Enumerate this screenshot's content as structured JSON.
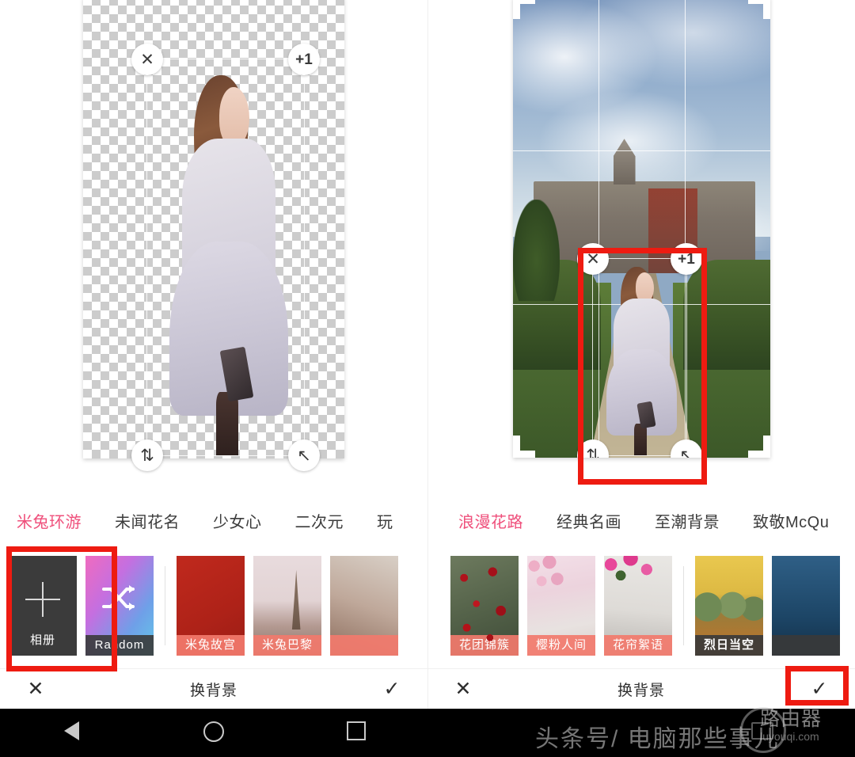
{
  "app": {
    "bottom_bar_title": "换背景",
    "cancel_icon": "✕",
    "confirm_icon": "✓"
  },
  "left_screen": {
    "canvas_type": "transparent-checkerboard",
    "selection": {
      "delete_label": "✕",
      "count_badge": "+1",
      "flip_label": "⇅",
      "resize_label": "↖"
    },
    "tabs": [
      {
        "label": "米兔环游",
        "active": true
      },
      {
        "label": "未闻花名",
        "active": false
      },
      {
        "label": "少女心",
        "active": false
      },
      {
        "label": "二次元",
        "active": false
      },
      {
        "label": "玩",
        "active": false
      }
    ],
    "thumbs": [
      {
        "label": "相册",
        "kind": "album-picker"
      },
      {
        "label": "Random",
        "kind": "random"
      },
      {
        "label": "米兔故宫",
        "kind": "photo"
      },
      {
        "label": "米兔巴黎",
        "kind": "photo"
      },
      {
        "label": "",
        "kind": "photo"
      }
    ],
    "bottom": {
      "cancel": "✕",
      "title": "换背景",
      "confirm": "✓"
    }
  },
  "right_screen": {
    "canvas_type": "photo-castle-garden",
    "selection": {
      "delete_label": "✕",
      "count_badge": "+1",
      "flip_label": "⇅",
      "resize_label": "↖"
    },
    "tabs": [
      {
        "label": "浪漫花路",
        "active": true
      },
      {
        "label": "经典名画",
        "active": false
      },
      {
        "label": "至潮背景",
        "active": false
      },
      {
        "label": "致敬McQu",
        "active": false
      }
    ],
    "thumbs": [
      {
        "label": "花团锦簇",
        "kind": "photo"
      },
      {
        "label": "樱粉人间",
        "kind": "photo"
      },
      {
        "label": "花帘絮语",
        "kind": "photo"
      },
      {
        "label": "烈日当空",
        "kind": "painting"
      },
      {
        "label": "",
        "kind": "painting"
      }
    ],
    "bottom": {
      "cancel": "✕",
      "title": "换背景",
      "confirm": "✓"
    }
  },
  "navbar": {
    "back": "back-triangle",
    "home": "home-circle",
    "recents": "recents-square"
  },
  "watermark": {
    "main": "头条号/ 电脑那些事儿",
    "brand": "路由器",
    "url": "luyouqi.com"
  },
  "annotations": {
    "album_box": "highlight-album-button",
    "confirm_box": "highlight-confirm-button",
    "person_box": "highlight-pasted-person"
  },
  "colors": {
    "accent_pink": "#ef4f7b",
    "annotation_red": "#ee1b11",
    "thumb_label_bg": "#f27a6c",
    "navbar_bg": "#000000"
  }
}
